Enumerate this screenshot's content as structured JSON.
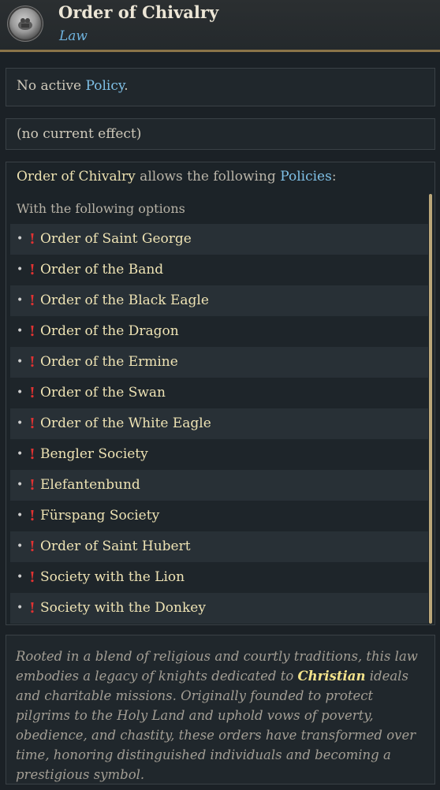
{
  "header": {
    "title": "Order of Chivalry",
    "subtitle": "Law",
    "emblem_icon": "templar-seal-icon"
  },
  "policy": {
    "prefix": "No active ",
    "link": "Policy",
    "suffix": "."
  },
  "effect": {
    "text": "(no current effect)"
  },
  "allowed": {
    "law_name": "Order of Chivalry",
    "middle": " allows the following ",
    "link": "Policies",
    "suffix": ":",
    "options_label": "With the following options",
    "items": [
      {
        "label": "Order of Saint George"
      },
      {
        "label": "Order of the Band"
      },
      {
        "label": "Order of the Black Eagle"
      },
      {
        "label": "Order of the Dragon"
      },
      {
        "label": "Order of the Ermine"
      },
      {
        "label": "Order of the Swan"
      },
      {
        "label": "Order of the White Eagle"
      },
      {
        "label": "Bengler Society"
      },
      {
        "label": "Elefantenbund"
      },
      {
        "label": "Fürspang Society"
      },
      {
        "label": "Order of Saint Hubert"
      },
      {
        "label": "Society with the Lion"
      },
      {
        "label": "Society with the Donkey"
      }
    ]
  },
  "description": {
    "before": "Rooted in a blend of religious and courtly traditions, this law embodies a legacy of knights dedicated to ",
    "highlight": "Christian",
    "after": " ideals and charitable missions. Originally founded to protect pilgrims to the Holy Land and uphold vows of poverty, obedience, and chastity, these orders have transformed over time, honoring distinguished individuals and becoming a prestigious symbol."
  },
  "colors": {
    "accent_gold": "#8a7448",
    "link_blue": "#7fc0e6",
    "warning_red": "#e03232"
  }
}
